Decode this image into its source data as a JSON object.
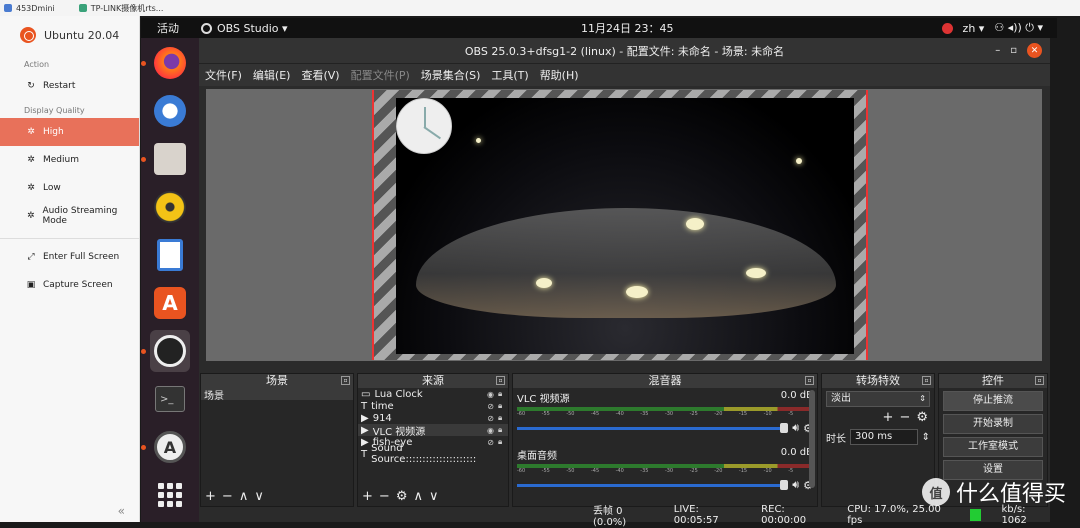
{
  "host": {
    "tabs": [
      "453Dmini",
      "TP-LINK摄像机rts..."
    ]
  },
  "remote": {
    "title": "Ubuntu 20.04",
    "section_action": "Action",
    "restart": "Restart",
    "section_display": "Display Quality",
    "high": "High",
    "medium": "Medium",
    "low": "Low",
    "audio": "Audio Streaming Mode",
    "fullscreen": "Enter Full Screen",
    "capture": "Capture Screen",
    "collapse": "«"
  },
  "topbar": {
    "activities": "活动",
    "app": "OBS Studio ▾",
    "clock": "11月24日  23：45",
    "lang": "zh ▾",
    "tray": "⚇ ◂)) ⏻ ▾"
  },
  "window": {
    "title": "OBS 25.0.3+dfsg1-2 (linux) - 配置文件: 未命名 - 场景: 未命名",
    "menu": [
      "文件(F)",
      "编辑(E)",
      "查看(V)",
      "配置文件(P)",
      "场景集合(S)",
      "工具(T)",
      "帮助(H)"
    ]
  },
  "scenes": {
    "title": "场景",
    "items": [
      "场景"
    ]
  },
  "sources": {
    "title": "来源",
    "items": [
      {
        "icon": "▭",
        "name": "Lua Clock"
      },
      {
        "icon": "T",
        "name": "time"
      },
      {
        "icon": "▶",
        "name": "914"
      },
      {
        "icon": "▶",
        "name": "VLC 视频源"
      },
      {
        "icon": "▶",
        "name": "fish-eye"
      },
      {
        "icon": "T",
        "name": "Sound Source:::::::::::::::::::::"
      }
    ]
  },
  "mixer": {
    "title": "混音器",
    "channels": [
      {
        "name": "VLC 视频源",
        "db": "0.0 dB"
      },
      {
        "name": "桌面音频",
        "db": "0.0 dB"
      }
    ],
    "ticks": [
      "-60",
      "-55",
      "-50",
      "-45",
      "-40",
      "-35",
      "-30",
      "-25",
      "-20",
      "-15",
      "-10",
      "-5",
      "0"
    ]
  },
  "transitions": {
    "title": "转场特效",
    "selected": "淡出",
    "duration_label": "时长",
    "duration_value": "300 ms"
  },
  "controls": {
    "title": "控件",
    "stop_stream": "停止推流",
    "start_record": "开始录制",
    "studio_mode": "工作室模式",
    "settings": "设置"
  },
  "status": {
    "dropped": "丢帧 0 (0.0%)",
    "live": "LIVE: 00:05:57",
    "rec": "REC: 00:00:00",
    "cpu": "CPU: 17.0%, 25.00 fps",
    "kbps": "kb/s: 1062"
  },
  "watermark": {
    "logo": "值",
    "text": "什么值得买"
  }
}
